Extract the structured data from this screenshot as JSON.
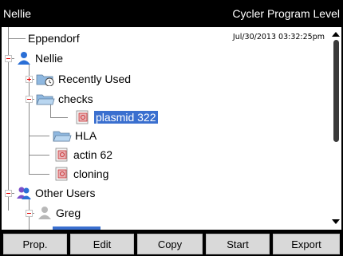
{
  "header": {
    "left_title": "Nellie",
    "right_title": "Cycler Program Level"
  },
  "timestamp": "Jul/30/2013 03:32:25pm",
  "tree": {
    "root": "Eppendorf",
    "user_nellie": "Nellie",
    "recently_used": "Recently Used",
    "checks": "checks",
    "plasmid": "plasmid 322",
    "hla": "HLA",
    "actin": "actin 62",
    "cloning": "cloning",
    "other_users": "Other Users",
    "greg": "Greg"
  },
  "buttons": {
    "prop": "Prop.",
    "edit": "Edit",
    "copy": "Copy",
    "start": "Start",
    "export": "Export"
  },
  "colors": {
    "selection": "#3a6fcf",
    "expander_sign": "#e00000",
    "program_icon": "#e8b4b8",
    "folder_icon": "#8fb8e0",
    "user_icon": "#2a6fd6"
  },
  "icons": {
    "user": "person-icon",
    "users": "people-icon",
    "folder": "folder-icon",
    "recent": "recent-folder-icon",
    "program": "program-file-icon"
  }
}
